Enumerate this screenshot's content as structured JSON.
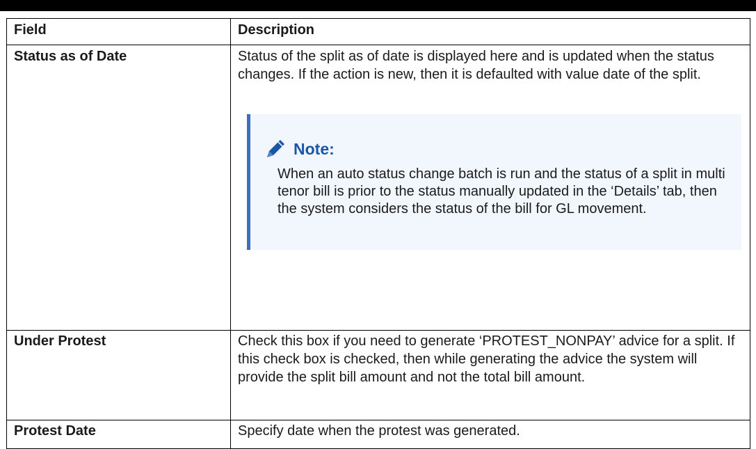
{
  "table": {
    "headers": {
      "field": "Field",
      "description": "Description"
    },
    "rows": [
      {
        "field": "Status as of Date",
        "description": "Status of the split as of date is displayed here and is updated when the status changes. If the action is new, then it is defaulted with value date of the split.",
        "note": {
          "title": "Note:",
          "icon": "pencil-icon",
          "text": "When an auto status change batch is run and the status of a split in multi tenor bill is prior to the status manually updated in the ‘Details’ tab, then the system considers the status of the bill for GL movement."
        }
      },
      {
        "field": "Under Protest",
        "description": "Check this box if you need to generate ‘PROTEST_NONPAY’ advice for a split. If this check box is checked, then while generating the advice the system will provide the split bill amount and not the total bill amount."
      },
      {
        "field": "Protest Date",
        "description": "Specify date when the protest was generated."
      }
    ]
  },
  "colors": {
    "note_accent": "#3b6fbf",
    "note_title": "#1a57a7",
    "note_bg": "#f2f7fd"
  }
}
